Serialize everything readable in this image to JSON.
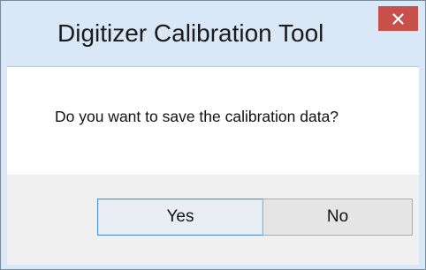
{
  "dialog": {
    "title": "Digitizer Calibration Tool",
    "message": "Do you want to save the calibration data?",
    "buttons": {
      "yes_label": "Yes",
      "no_label": "No"
    },
    "close_icon": "close-icon",
    "colors": {
      "titlebar": "#d9e8f7",
      "close_button": "#c7504a",
      "button_bar": "#f0f0f0",
      "default_button_border": "#4b8fd6"
    }
  }
}
